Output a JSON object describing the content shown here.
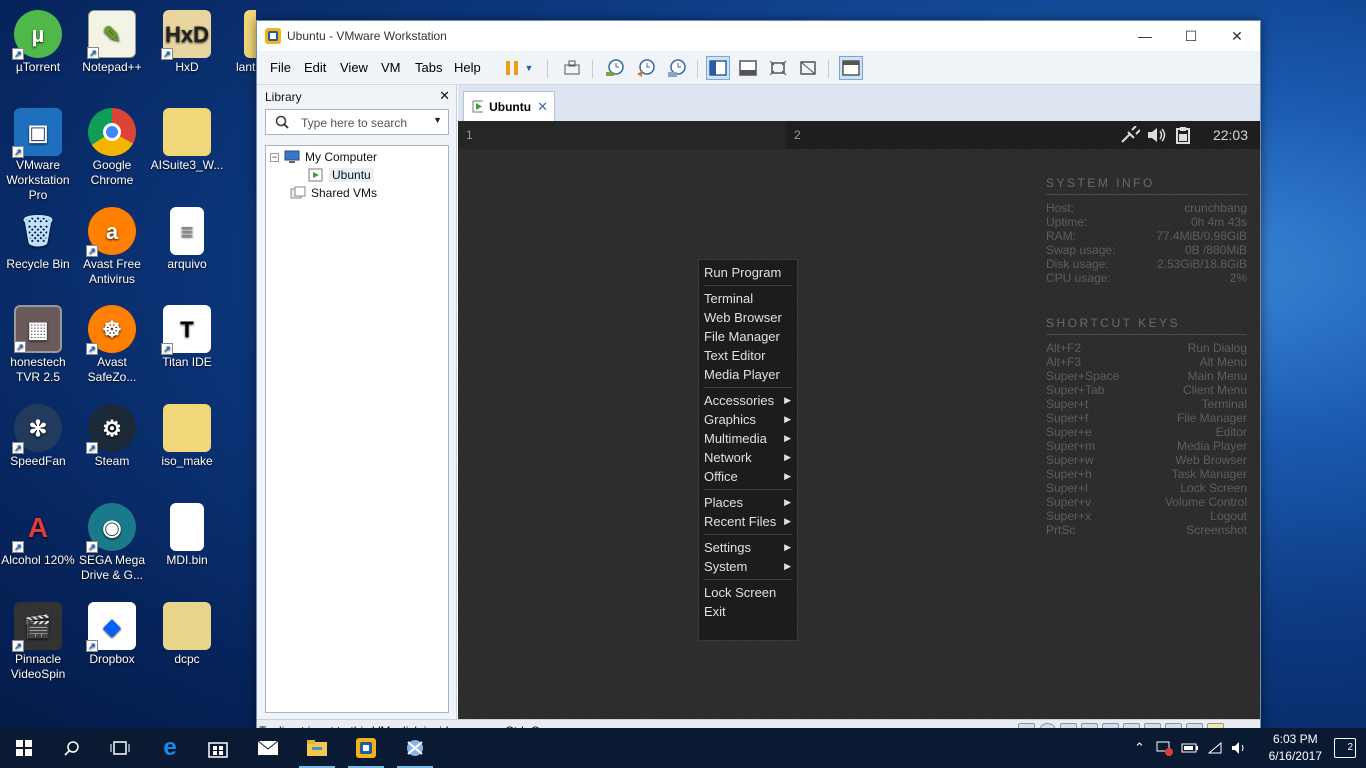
{
  "desktop": {
    "icons": [
      {
        "label": "µTorrent"
      },
      {
        "label": "Notepad++"
      },
      {
        "label": "HxD"
      },
      {
        "label": "lant"
      },
      {
        "label": "VMware Workstation Pro"
      },
      {
        "label": "Google Chrome"
      },
      {
        "label": "AISuite3_W..."
      },
      {
        "label": "Recycle Bin"
      },
      {
        "label": "Avast Free Antivirus"
      },
      {
        "label": "arquivo"
      },
      {
        "label": "honestech TVR 2.5"
      },
      {
        "label": "Avast SafeZo..."
      },
      {
        "label": "Titan IDE"
      },
      {
        "label": "SpeedFan"
      },
      {
        "label": "Steam"
      },
      {
        "label": "iso_make"
      },
      {
        "label": "Alcohol 120%"
      },
      {
        "label": "SEGA Mega Drive & G..."
      },
      {
        "label": "MDI.bin"
      },
      {
        "label": "Pinnacle VideoSpin"
      },
      {
        "label": "Dropbox"
      },
      {
        "label": "dcpc"
      }
    ]
  },
  "window": {
    "title": "Ubuntu - VMware Workstation",
    "menu": [
      "File",
      "Edit",
      "View",
      "VM",
      "Tabs",
      "Help"
    ],
    "library": {
      "title": "Library",
      "search_placeholder": "Type here to search",
      "tree": {
        "root": "My Computer",
        "child": "Ubuntu",
        "shared": "Shared VMs"
      }
    },
    "tab": {
      "label": "Ubuntu"
    },
    "status": "To direct input to this VM, click inside or press Ctrl+G."
  },
  "vm": {
    "workspaces": [
      "1",
      "2"
    ],
    "clock": "22:03",
    "system_info": {
      "heading": "SYSTEM INFO",
      "rows": [
        {
          "k": "Host:",
          "v": "crunchbang"
        },
        {
          "k": "Uptime:",
          "v": "0h 4m 43s"
        },
        {
          "k": "RAM:",
          "v": "77.4MiB/0.98GiB"
        },
        {
          "k": "Swap usage:",
          "v": "0B  /880MiB"
        },
        {
          "k": "Disk usage:",
          "v": "2.53GiB/18.8GiB"
        },
        {
          "k": "CPU usage:",
          "v": "2%"
        }
      ]
    },
    "shortcuts": {
      "heading": "SHORTCUT KEYS",
      "rows": [
        {
          "k": "Alt+F2",
          "v": "Run Dialog"
        },
        {
          "k": "Alt+F3",
          "v": "Alt Menu"
        },
        {
          "k": "Super+Space",
          "v": "Main Menu"
        },
        {
          "k": "Super+Tab",
          "v": "Client Menu"
        },
        {
          "k": "Super+t",
          "v": "Terminal"
        },
        {
          "k": "Super+f",
          "v": "File Manager"
        },
        {
          "k": "Super+e",
          "v": "Editor"
        },
        {
          "k": "Super+m",
          "v": "Media Player"
        },
        {
          "k": "Super+w",
          "v": "Web Browser"
        },
        {
          "k": "Super+h",
          "v": "Task Manager"
        },
        {
          "k": "Super+l",
          "v": "Lock Screen"
        },
        {
          "k": "Super+v",
          "v": "Volume Control"
        },
        {
          "k": "Super+x",
          "v": "Logout"
        },
        {
          "k": "PrtSc",
          "v": "Screenshot"
        }
      ]
    },
    "menu": {
      "items": [
        {
          "label": "Run Program"
        },
        {
          "label": "Terminal"
        },
        {
          "label": "Web Browser"
        },
        {
          "label": "File Manager"
        },
        {
          "label": "Text Editor"
        },
        {
          "label": "Media Player"
        },
        {
          "label": "Accessories"
        },
        {
          "label": "Graphics"
        },
        {
          "label": "Multimedia"
        },
        {
          "label": "Network"
        },
        {
          "label": "Office"
        },
        {
          "label": "Places"
        },
        {
          "label": "Recent Files"
        },
        {
          "label": "Settings"
        },
        {
          "label": "System"
        },
        {
          "label": "Lock Screen"
        },
        {
          "label": "Exit"
        }
      ]
    }
  },
  "taskbar": {
    "time": "6:03 PM",
    "date": "6/16/2017",
    "notifications": "2"
  }
}
